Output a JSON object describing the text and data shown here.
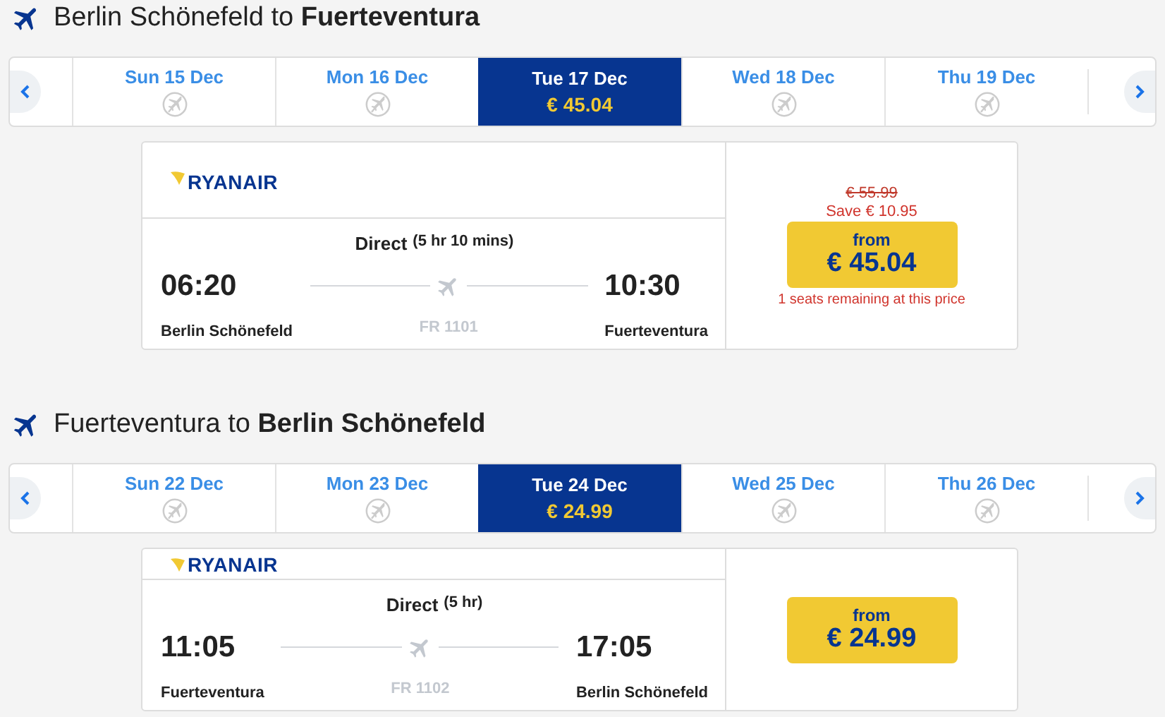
{
  "sections": [
    {
      "heading": "Berlin Schönefeld to **Fuerteventura**",
      "dates": [
        {
          "label": "Sun 15 Dec",
          "selected": false
        },
        {
          "label": "Mon 16 Dec",
          "selected": false
        },
        {
          "label": "Tue 17 Dec",
          "price": "€ 45.04",
          "selected": true
        },
        {
          "label": "Wed 18 Dec",
          "selected": false
        },
        {
          "label": "Thu 19 Dec",
          "selected": false
        }
      ],
      "flight": {
        "airline": "RYANAIR",
        "type": "Direct",
        "duration": "(5 hr 10 mins)",
        "depart_time": "06:20",
        "depart_airport": "Berlin Schönefeld",
        "arrive_time": "10:30",
        "arrive_airport": "Fuerteventura",
        "flight_number": "FR 1101",
        "original_price": "€ 55.99",
        "saving": "Save  € 10.95",
        "price_label": "from",
        "price": "€ 45.04",
        "seats_note": "1 seats remaining at this price"
      }
    },
    {
      "heading": "Fuerteventura to **Berlin Schönefeld**",
      "dates": [
        {
          "label": "Sun 22 Dec",
          "selected": false
        },
        {
          "label": "Mon 23 Dec",
          "selected": false
        },
        {
          "label": "Tue 24 Dec",
          "price": "€ 24.99",
          "selected": true
        },
        {
          "label": "Wed 25 Dec",
          "selected": false
        },
        {
          "label": "Thu 26 Dec",
          "selected": false
        }
      ],
      "flight": {
        "airline": "RYANAIR",
        "type": "Direct",
        "duration": "(5 hr)",
        "depart_time": "11:05",
        "depart_airport": "Fuerteventura",
        "arrive_time": "17:05",
        "arrive_airport": "Berlin Schönefeld",
        "flight_number": "FR 1102",
        "price_label": "from",
        "price": "€ 24.99"
      }
    }
  ]
}
